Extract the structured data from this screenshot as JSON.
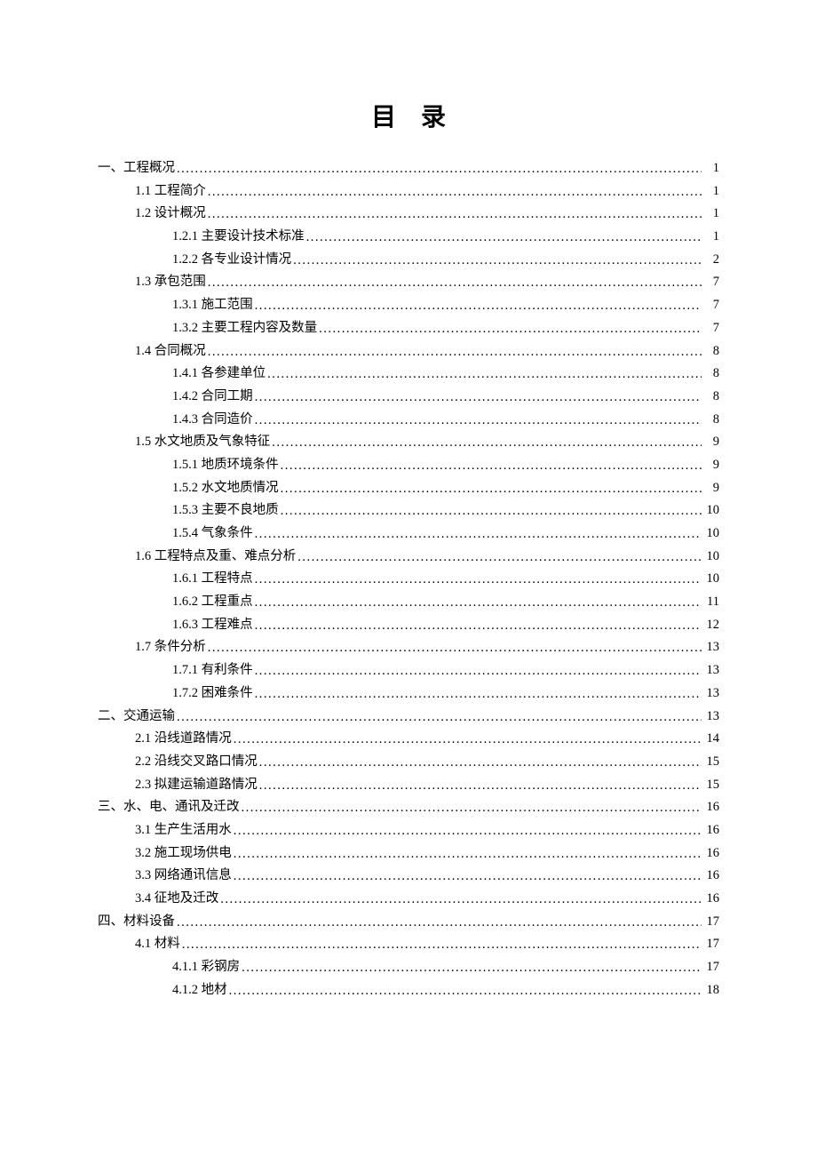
{
  "title": "目录",
  "toc": [
    {
      "level": 1,
      "label": "一、工程概况",
      "page": "1"
    },
    {
      "level": 2,
      "label": "1.1 工程简介",
      "page": "1"
    },
    {
      "level": 2,
      "label": "1.2 设计概况",
      "page": "1"
    },
    {
      "level": 3,
      "label": "1.2.1 主要设计技术标准",
      "page": "1"
    },
    {
      "level": 3,
      "label": "1.2.2 各专业设计情况",
      "page": "2"
    },
    {
      "level": 2,
      "label": "1.3 承包范围",
      "page": "7"
    },
    {
      "level": 3,
      "label": "1.3.1 施工范围",
      "page": "7"
    },
    {
      "level": 3,
      "label": "1.3.2 主要工程内容及数量",
      "page": "7"
    },
    {
      "level": 2,
      "label": "1.4 合同概况",
      "page": "8"
    },
    {
      "level": 3,
      "label": "1.4.1 各参建单位",
      "page": "8"
    },
    {
      "level": 3,
      "label": "1.4.2 合同工期",
      "page": "8"
    },
    {
      "level": 3,
      "label": "1.4.3 合同造价",
      "page": "8"
    },
    {
      "level": 2,
      "label": "1.5 水文地质及气象特征",
      "page": "9"
    },
    {
      "level": 3,
      "label": "1.5.1 地质环境条件",
      "page": "9"
    },
    {
      "level": 3,
      "label": "1.5.2 水文地质情况",
      "page": "9"
    },
    {
      "level": 3,
      "label": "1.5.3 主要不良地质",
      "page": "10"
    },
    {
      "level": 3,
      "label": "1.5.4 气象条件",
      "page": "10"
    },
    {
      "level": 2,
      "label": "1.6 工程特点及重、难点分析",
      "page": "10"
    },
    {
      "level": 3,
      "label": "1.6.1 工程特点",
      "page": "10"
    },
    {
      "level": 3,
      "label": "1.6.2 工程重点",
      "page": "11"
    },
    {
      "level": 3,
      "label": "1.6.3 工程难点",
      "page": "12"
    },
    {
      "level": 2,
      "label": "1.7 条件分析",
      "page": "13"
    },
    {
      "level": 3,
      "label": "1.7.1 有利条件",
      "page": "13"
    },
    {
      "level": 3,
      "label": "1.7.2 困难条件",
      "page": "13"
    },
    {
      "level": 1,
      "label": "二、交通运输",
      "page": "13"
    },
    {
      "level": 2,
      "label": "2.1 沿线道路情况",
      "page": "14"
    },
    {
      "level": 2,
      "label": "2.2  沿线交叉路口情况",
      "page": "15"
    },
    {
      "level": 2,
      "label": "2.3 拟建运输道路情况",
      "page": "15"
    },
    {
      "level": 1,
      "label": "三、水、电、通讯及迁改",
      "page": "16"
    },
    {
      "level": 2,
      "label": "3.1 生产生活用水",
      "page": "16"
    },
    {
      "level": 2,
      "label": "3.2 施工现场供电",
      "page": "16"
    },
    {
      "level": 2,
      "label": "3.3 网络通讯信息",
      "page": "16"
    },
    {
      "level": 2,
      "label": "3.4 征地及迁改",
      "page": "16"
    },
    {
      "level": 1,
      "label": "四、材料设备",
      "page": "17"
    },
    {
      "level": 2,
      "label": "4.1 材料",
      "page": "17"
    },
    {
      "level": 3,
      "label": "4.1.1 彩钢房",
      "page": "17"
    },
    {
      "level": 3,
      "label": "4.1.2 地材",
      "page": "18"
    }
  ]
}
